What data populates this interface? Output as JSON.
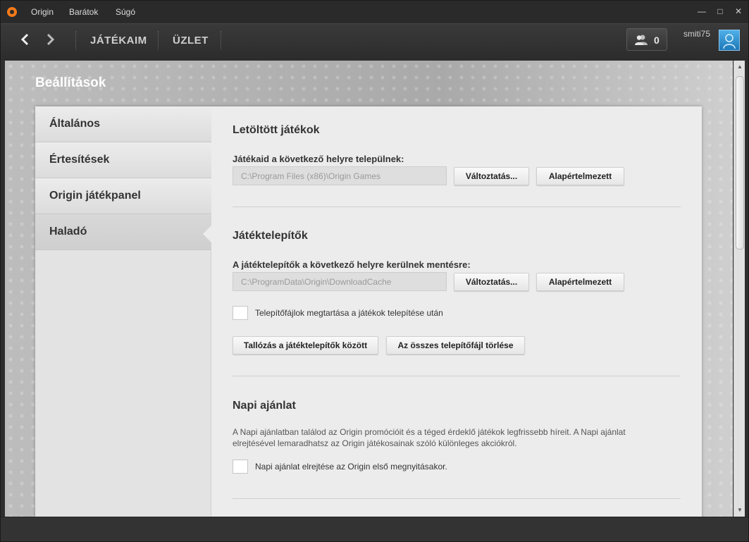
{
  "titlebar": {
    "menu": [
      "Origin",
      "Barátok",
      "Súgó"
    ],
    "window_buttons": {
      "minimize": "—",
      "maximize": "□",
      "close": "✕"
    }
  },
  "navbar": {
    "back_icon": "chevron-left-icon",
    "forward_icon": "chevron-right-icon",
    "links": [
      "JÁTÉKAIM",
      "ÜZLET"
    ],
    "friends_count": "0",
    "username": "smiti75"
  },
  "page": {
    "title": "Beállítások"
  },
  "sidebar": {
    "items": [
      {
        "label": "Általános"
      },
      {
        "label": "Értesítések"
      },
      {
        "label": "Origin játékpanel"
      },
      {
        "label": "Haladó"
      }
    ],
    "active_index": 3
  },
  "sections": {
    "downloaded": {
      "title": "Letöltött játékok",
      "label": "Játékaid a következő helyre települnek:",
      "path": "C:\\Program Files (x86)\\Origin Games",
      "change_button": "Változtatás...",
      "default_button": "Alapértelmezett"
    },
    "installers": {
      "title": "Játéktelepítők",
      "label": "A játéktelepítők a következő helyre kerülnek mentésre:",
      "path": "C:\\ProgramData\\Origin\\DownloadCache",
      "change_button": "Változtatás...",
      "default_button": "Alapértelmezett",
      "keep_checkbox_label": "Telepítőfájlok megtartása a játékok telepítése után",
      "keep_checked": false,
      "browse_button": "Tallózás a játéktelepítők között",
      "delete_button": "Az összes telepítőfájl törlése"
    },
    "daily": {
      "title": "Napi ajánlat",
      "description": "A Napi ajánlatban találod az Origin promócióit és a téged érdeklő játékok legfrissebb híreit. A Napi ajánlat elrejtésével lemaradhatsz az Origin játékosainak szóló különleges akciókról.",
      "hide_checkbox_label": "Napi ajánlat elrejtése az Origin első megnyitásakor.",
      "hide_checked": false
    }
  },
  "colors": {
    "accent_logo": "#f07a1a",
    "titlebar": "#2a2a2a",
    "panel": "#ececec"
  }
}
